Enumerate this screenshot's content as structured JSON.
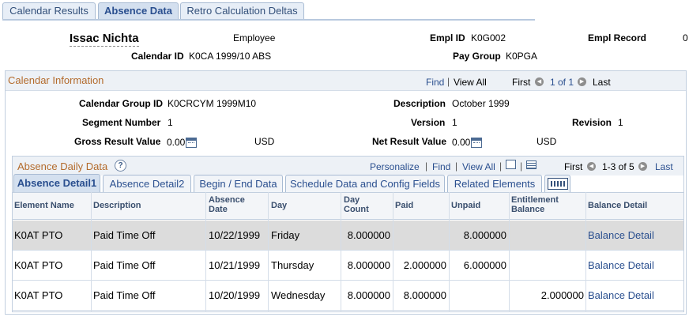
{
  "top_tabs": [
    {
      "label": "Calendar Results",
      "active": false
    },
    {
      "label": "Absence Data",
      "active": true
    },
    {
      "label": "Retro Calculation Deltas",
      "active": false
    }
  ],
  "header": {
    "name": "Issac Nichta",
    "role": "Employee",
    "empl_id_label": "Empl ID",
    "empl_id_value": "K0G002",
    "empl_record_label": "Empl Record",
    "empl_record_value": "0",
    "calendar_id_label": "Calendar ID",
    "calendar_id_value": "K0CA 1999/10 ABS",
    "pay_group_label": "Pay Group",
    "pay_group_value": "K0PGA"
  },
  "calendar_info": {
    "title": "Calendar Information",
    "find": "Find",
    "view_all": "View All",
    "first": "First",
    "page": "1 of 1",
    "last": "Last",
    "calendar_group_id_label": "Calendar Group ID",
    "calendar_group_id_value": "K0CRCYM 1999M10",
    "description_label": "Description",
    "description_value": "October 1999",
    "segment_number_label": "Segment Number",
    "segment_number_value": "1",
    "version_label": "Version",
    "version_value": "1",
    "revision_label": "Revision",
    "revision_value": "1",
    "gross_label": "Gross Result Value",
    "gross_value": "0.00",
    "gross_currency": "USD",
    "net_label": "Net Result Value",
    "net_value": "0.00",
    "net_currency": "USD"
  },
  "absence_daily": {
    "title": "Absence Daily Data",
    "personalize": "Personalize",
    "find": "Find",
    "view_all": "View All",
    "first": "First",
    "range": "1-3 of 5",
    "last": "Last",
    "sub_tabs": [
      "Absence Detail1",
      "Absence Detail2",
      "Begin / End Data",
      "Schedule Data and Config Fields",
      "Related Elements"
    ],
    "columns": [
      "Element Name",
      "Description",
      "Absence Date",
      "Day",
      "Day Count",
      "Paid",
      "Unpaid",
      "Entitlement Balance",
      "Balance Detail"
    ],
    "rows": [
      {
        "element": "K0AT PTO",
        "description": "Paid Time Off",
        "date": "10/22/1999",
        "day": "Friday",
        "day_count": "8.000000",
        "paid": "",
        "unpaid": "8.000000",
        "entitlement": "",
        "balance": "Balance Detail"
      },
      {
        "element": "K0AT PTO",
        "description": "Paid Time Off",
        "date": "10/21/1999",
        "day": "Thursday",
        "day_count": "8.000000",
        "paid": "2.000000",
        "unpaid": "6.000000",
        "entitlement": "",
        "balance": "Balance Detail"
      },
      {
        "element": "K0AT PTO",
        "description": "Paid Time Off",
        "date": "10/20/1999",
        "day": "Wednesday",
        "day_count": "8.000000",
        "paid": "8.000000",
        "unpaid": "",
        "entitlement": "2.000000",
        "balance": "Balance Detail"
      }
    ]
  },
  "icons": {
    "nav_prev": "left-arrow-icon",
    "nav_next": "right-arrow-icon",
    "calculator": "calculator-icon",
    "help": "help-icon",
    "new_window": "new-window-icon",
    "download": "grid-download-icon",
    "show_all_columns": "show-all-columns-icon"
  }
}
